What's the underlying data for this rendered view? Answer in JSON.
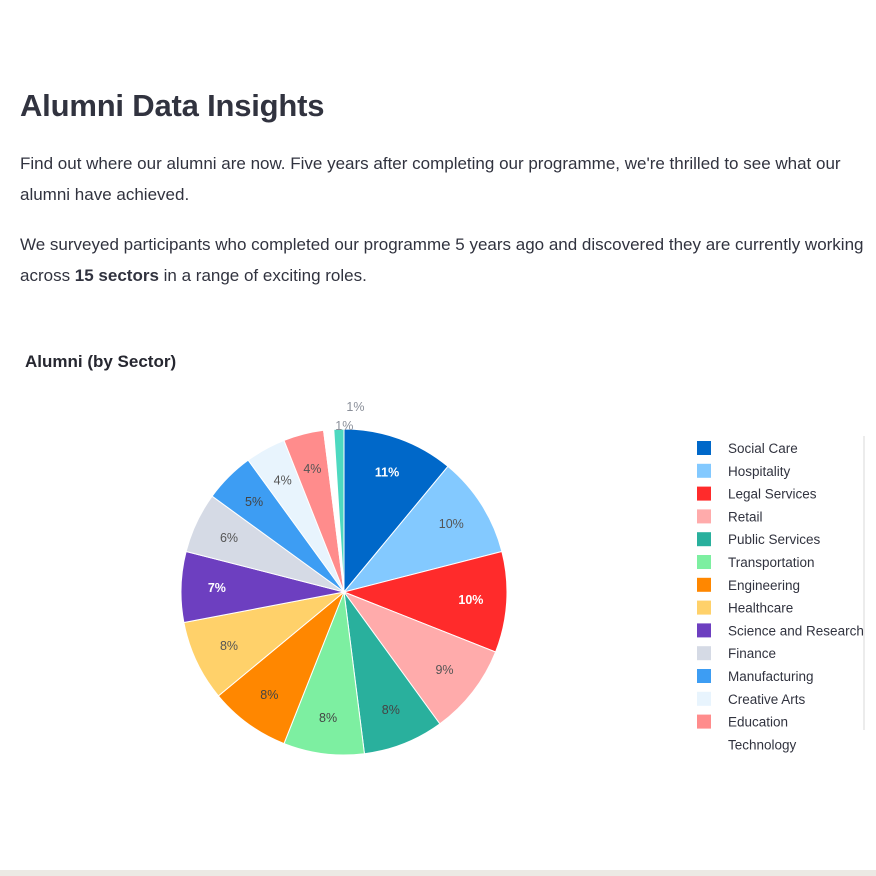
{
  "page": {
    "title": "Alumni Data Insights",
    "paragraph1": "Find out where our alumni are now. Five years after completing our programme, we're thrilled to see what our alumni have achieved.",
    "paragraph2_prefix": "We surveyed participants who completed our programme 5 years ago and discovered they are currently working across ",
    "paragraph2_bold": "15 sectors",
    "paragraph2_suffix": " in a range of exciting roles."
  },
  "chart_data": {
    "type": "pie",
    "title": "Alumni (by Sector)",
    "legend_placement": "right",
    "slices": [
      {
        "label": "Social Care",
        "value": 11,
        "percent_label": "11%",
        "color": "#0068c9",
        "text_color": "#ffffff"
      },
      {
        "label": "Hospitality",
        "value": 10,
        "percent_label": "10%",
        "color": "#83c9ff",
        "text_color": "#555555"
      },
      {
        "label": "Legal Services",
        "value": 10,
        "percent_label": "10%",
        "color": "#ff2b2b",
        "text_color": "#ffffff"
      },
      {
        "label": "Retail",
        "value": 9,
        "percent_label": "9%",
        "color": "#ffabab",
        "text_color": "#555555"
      },
      {
        "label": "Public Services",
        "value": 8,
        "percent_label": "8%",
        "color": "#29b09d",
        "text_color": "#444444"
      },
      {
        "label": "Transportation",
        "value": 8,
        "percent_label": "8%",
        "color": "#7defa1",
        "text_color": "#444444"
      },
      {
        "label": "Engineering",
        "value": 8,
        "percent_label": "8%",
        "color": "#ff8700",
        "text_color": "#444444"
      },
      {
        "label": "Healthcare",
        "value": 8,
        "percent_label": "8%",
        "color": "#ffd16a",
        "text_color": "#555555"
      },
      {
        "label": "Science and Research",
        "value": 7,
        "percent_label": "7%",
        "color": "#6d3fc0",
        "text_color": "#ffffff"
      },
      {
        "label": "Finance",
        "value": 6,
        "percent_label": "6%",
        "color": "#d5dae5",
        "text_color": "#555555"
      },
      {
        "label": "Manufacturing",
        "value": 5,
        "percent_label": "5%",
        "color": "#3d9df3",
        "text_color": "#444444"
      },
      {
        "label": "Creative Arts",
        "value": 4,
        "percent_label": "4%",
        "color": "#e8f4fd",
        "text_color": "#555555"
      },
      {
        "label": "Education",
        "value": 4,
        "percent_label": "4%",
        "color": "#ff8c8c",
        "text_color": "#555555"
      },
      {
        "label": "Technology",
        "value": 1,
        "percent_label": "1%",
        "color": "#ffffff",
        "text_color": "#8a8f99"
      },
      {
        "label": "",
        "value": 1,
        "percent_label": "1%",
        "color": "#4dd9c0",
        "text_color": "#8a8f99"
      }
    ]
  }
}
